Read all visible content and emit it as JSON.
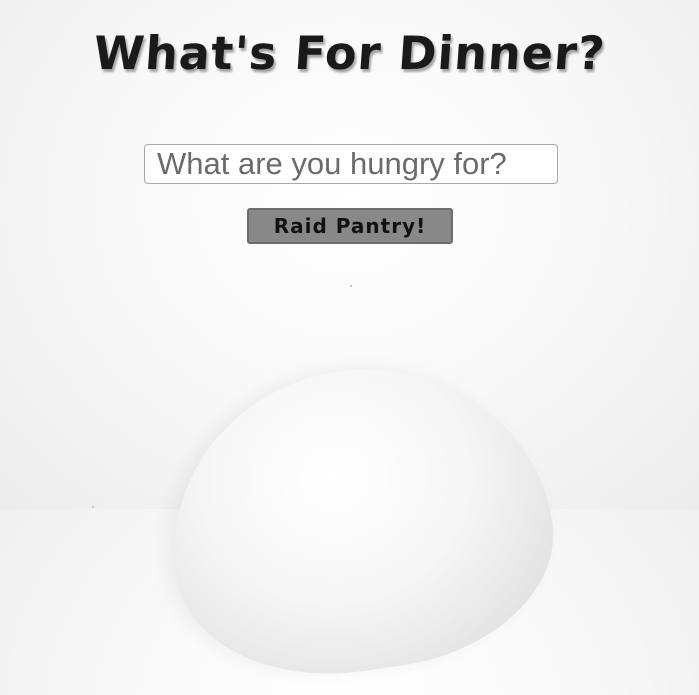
{
  "header": {
    "title": "What's For Dinner?"
  },
  "search": {
    "placeholder": "What are you hungry for?",
    "value": ""
  },
  "actions": {
    "raid_label": "Raid Pantry!"
  },
  "colors": {
    "button_bg": "#888888",
    "title_color": "#1a1a1a"
  }
}
